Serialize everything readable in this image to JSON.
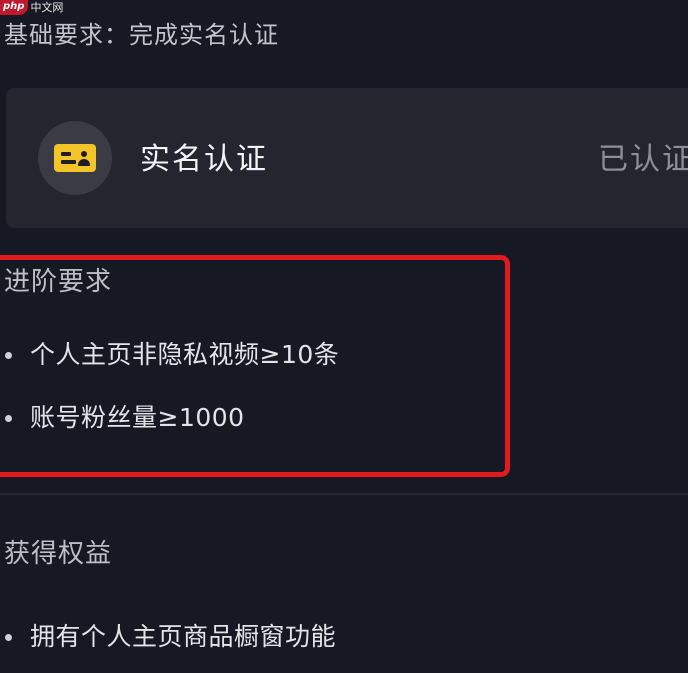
{
  "watermark": {
    "php": "php",
    "site": "中文网"
  },
  "basic_requirement": {
    "title": "基础要求：完成实名认证"
  },
  "verification_card": {
    "label": "实名认证",
    "status": "已认证",
    "icon": "id-card-icon",
    "icon_color": "#f2c428"
  },
  "advanced_requirement": {
    "title": "进阶要求",
    "items": [
      "个人主页非隐私视频≥10条",
      "账号粉丝量≥1000"
    ],
    "highlight_color": "#e01a1e"
  },
  "benefits": {
    "title": "获得权益",
    "items": [
      "拥有个人主页商品橱窗功能"
    ]
  },
  "colors": {
    "background": "#161823",
    "card": "#24252f"
  }
}
